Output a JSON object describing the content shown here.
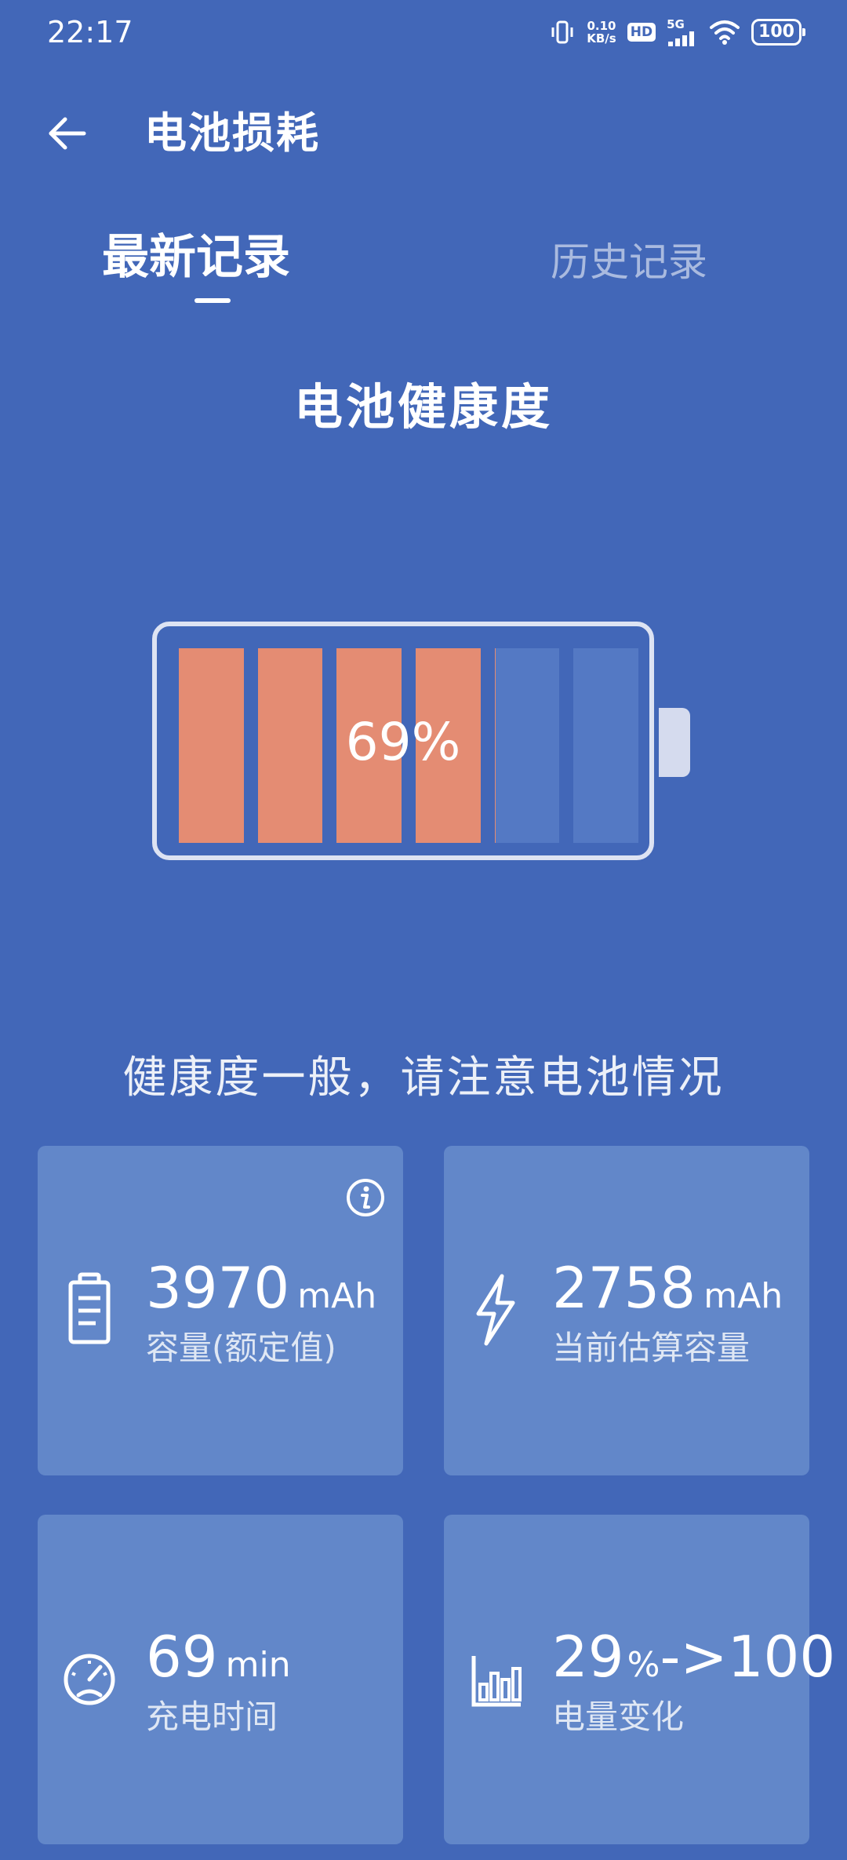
{
  "status_bar": {
    "time": "22:17",
    "net_speed_value": "0.10",
    "net_speed_unit": "KB/s",
    "hd_label": "HD",
    "signal_label": "5G",
    "battery_level": "100"
  },
  "header": {
    "title": "电池损耗"
  },
  "tabs": [
    {
      "label": "最新记录",
      "active": true
    },
    {
      "label": "历史记录",
      "active": false
    }
  ],
  "health": {
    "title": "电池健康度",
    "percent": 69,
    "percent_text": "69%",
    "status_text": "健康度一般，请注意电池情况"
  },
  "colors": {
    "background": "#4267b8",
    "card": "#6287c9",
    "battery_fill": "#e48c73",
    "battery_empty": "#5479c4"
  },
  "cards": [
    {
      "value": "3970",
      "unit": "mAh",
      "label": "容量(额定值)",
      "icon": "battery-document-icon",
      "has_info": true
    },
    {
      "value": "2758",
      "unit": "mAh",
      "label": "当前估算容量",
      "icon": "lightning-icon",
      "has_info": false
    },
    {
      "value": "69",
      "unit": "min",
      "label": "充电时间",
      "icon": "speedometer-icon",
      "has_info": false
    },
    {
      "value": "29",
      "unit": "%",
      "value_suffix": "->100",
      "label": "电量变化",
      "icon": "bar-chart-icon",
      "has_info": false
    }
  ]
}
